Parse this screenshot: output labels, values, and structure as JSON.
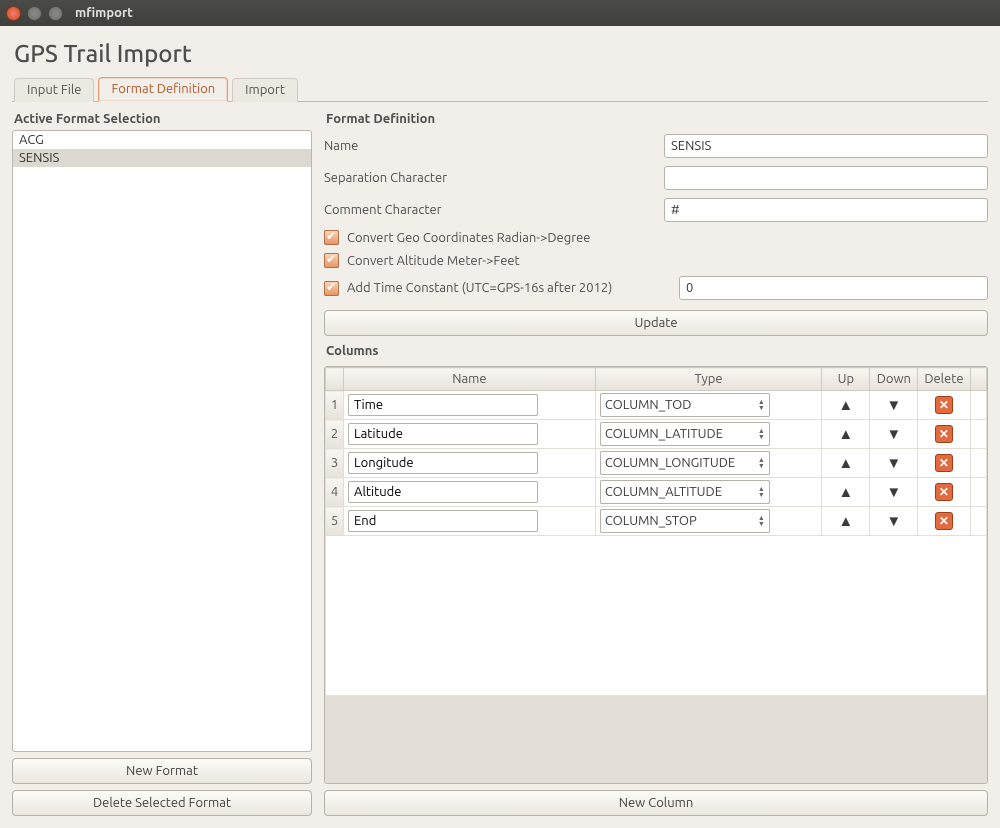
{
  "window": {
    "title": "mfimport"
  },
  "page": {
    "title": "GPS Trail Import"
  },
  "tabs": [
    {
      "label": "Input File",
      "active": false
    },
    {
      "label": "Format Definition",
      "active": true
    },
    {
      "label": "Import",
      "active": false
    }
  ],
  "left": {
    "heading": "Active Format Selection",
    "items": [
      {
        "label": "ACG",
        "selected": false
      },
      {
        "label": "SENSIS",
        "selected": true
      }
    ],
    "new_format_label": "New Format",
    "delete_format_label": "Delete Selected Format"
  },
  "format_def": {
    "heading": "Format Definition",
    "name_label": "Name",
    "name_value": "SENSIS",
    "sep_label": "Separation Character",
    "sep_value": "",
    "comment_label": "Comment Character",
    "comment_value": "#",
    "chk1_label": "Convert Geo Coordinates Radian->Degree",
    "chk2_label": "Convert Altitude Meter->Feet",
    "chk3_label": "Add Time Constant (UTC=GPS-16s after 2012)",
    "time_const_value": "0",
    "update_label": "Update"
  },
  "columns": {
    "heading": "Columns",
    "headers": {
      "name": "Name",
      "type": "Type",
      "up": "Up",
      "down": "Down",
      "delete": "Delete"
    },
    "rows": [
      {
        "num": "1",
        "name": "Time",
        "type": "COLUMN_TOD"
      },
      {
        "num": "2",
        "name": "Latitude",
        "type": "COLUMN_LATITUDE"
      },
      {
        "num": "3",
        "name": "Longitude",
        "type": "COLUMN_LONGITUDE"
      },
      {
        "num": "4",
        "name": "Altitude",
        "type": "COLUMN_ALTITUDE"
      },
      {
        "num": "5",
        "name": "End",
        "type": "COLUMN_STOP"
      }
    ],
    "new_column_label": "New Column"
  }
}
